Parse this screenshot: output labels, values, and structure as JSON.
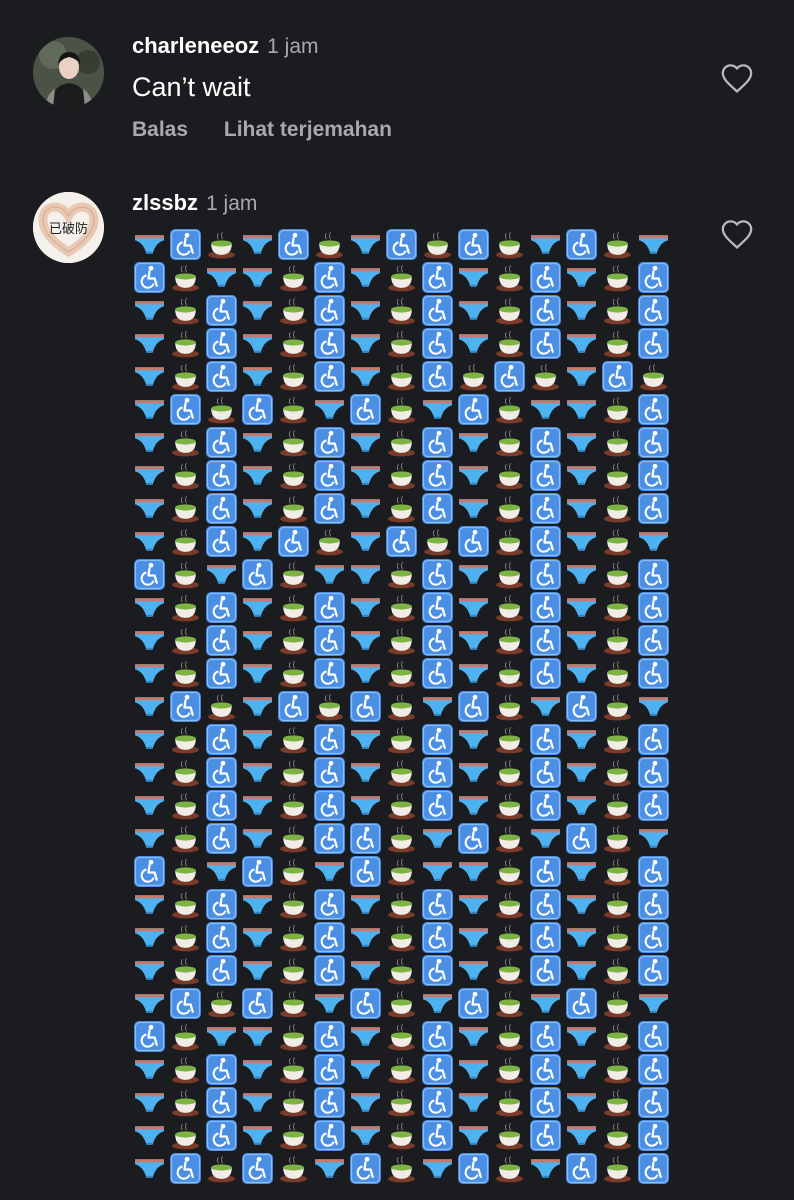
{
  "comments": [
    {
      "username": "charleneeoz",
      "time": "1 jam",
      "text": "Can’t wait",
      "actions": {
        "reply": "Balas",
        "translate": "Lihat terjemahan"
      }
    },
    {
      "username": "zlssbz",
      "time": "1 jam",
      "avatar_text": "已破防",
      "emoji_grid": {
        "legend": {
          "B": "briefs",
          "W": "wheelchair-symbol",
          "T": "teacup"
        },
        "rows": [
          "BWTBWTBWTWTBWTB",
          "WTBBTWBTWBTWBTW",
          "BTWBTWBTWBTWBTW",
          "BTWBTWBTWBTWBTW",
          "BTWBTWBTWTWTBWT",
          "BWTWTBWTBWTBBTW",
          "BTWBTWBTWBTWBTW",
          "BTWBTWBTWBTWBTW",
          "BTWBTWBTWBTWBTW",
          "BTWBWTBWTWTWBTB",
          "WTBWTBBTWBTWBTW",
          "BTWBTWBTWBTWBTW",
          "BTWBTWBTWBTWBTW",
          "BTWBTWBTWBTWBTW",
          "BWTBWTWTBWTBWTB",
          "BTWBTWBTWBTWBTW",
          "BTWBTWBTWBTWBTW",
          "BTWBTWBTWBTWBTW",
          "BTWBTWWTBWTBWTB",
          "WTBWTBWTBBTWBTW",
          "BTWBTWBTWBTWBTW",
          "BTWBTWBTWBTWBTW",
          "BTWBTWBTWBTWBTW",
          "BWTWTBWTBWTBWTB",
          "WTBBTWBTWBTWBTW",
          "BTWBTWBTWBTWBTW",
          "BTWBTWBTWBTWBTW",
          "BTWBTWBTWBTWBTW",
          "BWTWTBWTBWTBWTW"
        ]
      }
    }
  ],
  "colors": {
    "background": "#1b1c1f",
    "secondary_text": "#a7a9ae",
    "briefs": "#4fb2f0",
    "wheelchair": "#4a8fe3",
    "tea": "#7cb342"
  }
}
